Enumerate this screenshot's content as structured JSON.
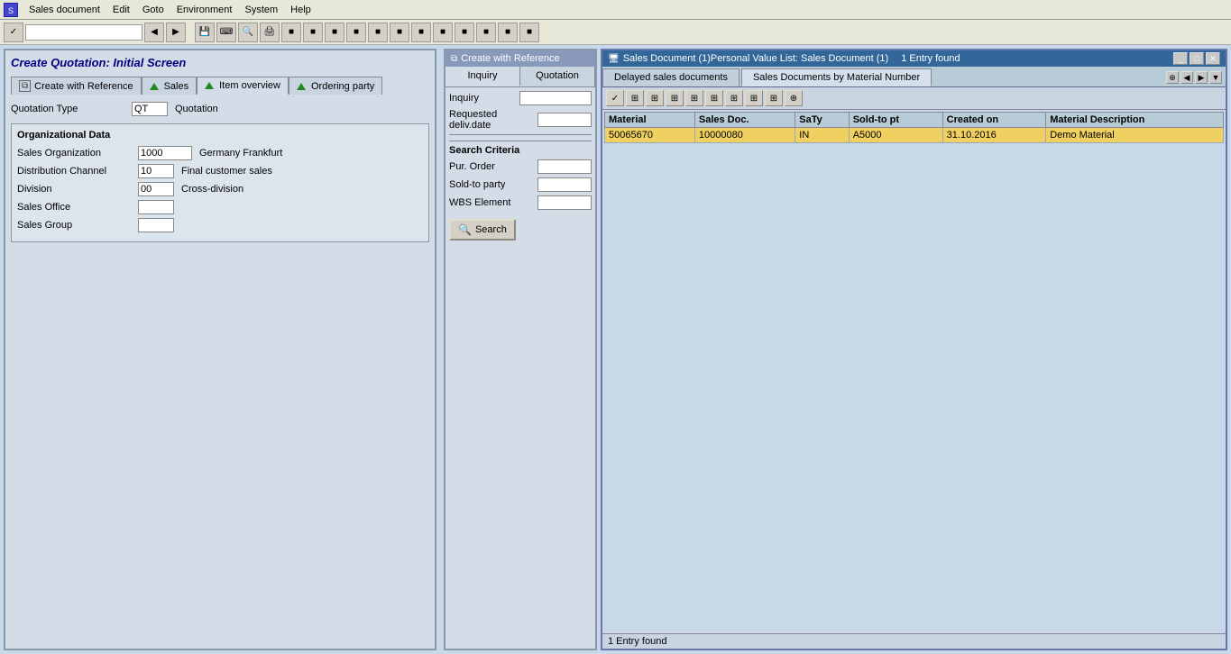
{
  "app": {
    "title": "Sales document",
    "menu_items": [
      "Sales document",
      "Edit",
      "Goto",
      "Environment",
      "System",
      "Help"
    ]
  },
  "main_window": {
    "title": "Create Quotation: Initial Screen"
  },
  "tabs": [
    {
      "label": "Create with Reference",
      "icon": "doc-icon"
    },
    {
      "label": "Sales",
      "icon": "tri-icon"
    },
    {
      "label": "Item overview",
      "icon": "tri-icon"
    },
    {
      "label": "Ordering party",
      "icon": "tri-icon"
    }
  ],
  "form": {
    "quotation_type_label": "Quotation Type",
    "quotation_type_value": "QT",
    "quotation_label": "Quotation",
    "quotation_value": ""
  },
  "org_data": {
    "title": "Organizational Data",
    "sales_org_label": "Sales Organization",
    "sales_org_value": "1000",
    "sales_org_desc": "Germany Frankfurt",
    "dist_channel_label": "Distribution Channel",
    "dist_channel_value": "10",
    "dist_channel_desc": "Final customer sales",
    "division_label": "Division",
    "division_value": "00",
    "division_desc": "Cross-division",
    "sales_office_label": "Sales Office",
    "sales_office_value": "",
    "sales_group_label": "Sales Group",
    "sales_group_value": ""
  },
  "reference_panel": {
    "title": "Create with Reference",
    "tabs": [
      {
        "label": "Inquiry",
        "active": true
      },
      {
        "label": "Quotation",
        "active": false
      }
    ],
    "inquiry_label": "Inquiry",
    "inquiry_value": "",
    "req_deliv_label": "Requested deliv.date",
    "req_deliv_value": "",
    "search_criteria_title": "Search Criteria",
    "pur_order_label": "Pur. Order",
    "pur_order_value": "",
    "sold_to_party_label": "Sold-to party",
    "sold_to_party_value": "",
    "wbs_element_label": "WBS Element",
    "wbs_element_value": "",
    "search_btn_label": "Search"
  },
  "right_window": {
    "title": "Sales Document (1)Personal Value List: Sales Document (1)",
    "entry_count": "1 Entry found",
    "tabs": [
      {
        "label": "Delayed sales documents",
        "active": false
      },
      {
        "label": "Sales Documents by Material Number",
        "active": true
      }
    ],
    "table": {
      "columns": [
        "Material",
        "Sales Doc.",
        "SaTy",
        "Sold-to pt",
        "Created on",
        "Material Description"
      ],
      "rows": [
        {
          "material": "50065670",
          "sales_doc": "10000080",
          "saty": "IN",
          "sold_to_pt": "A5000",
          "created_on": "31.10.2016",
          "material_desc": "Demo Material",
          "highlighted": true
        }
      ]
    }
  },
  "status_bar": {
    "text": "1 Entry found"
  }
}
